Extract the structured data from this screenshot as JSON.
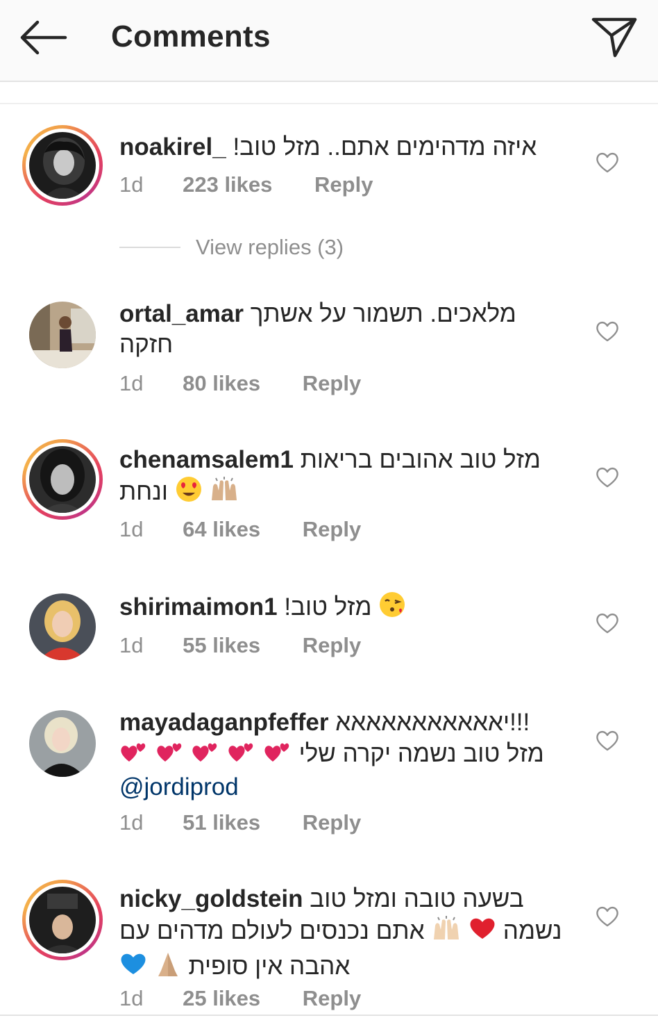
{
  "header": {
    "title": "Comments",
    "back_icon": "arrow-left-icon",
    "send_icon": "paper-plane-icon"
  },
  "colors": {
    "text": "#262626",
    "secondary": "#8e8e8e",
    "mention": "#003569",
    "story_ring": "#e4405f"
  },
  "comments": [
    {
      "username": "noakirel_",
      "text": "איזה מדהימים אתם.. מזל טוב!",
      "time": "1d",
      "likes": "223 likes",
      "reply": "Reply",
      "has_story_ring": true
    },
    {
      "username": "ortal_amar",
      "text": "מלאכים. תשמור על אשתך חזקה",
      "time": "1d",
      "likes": "80 likes",
      "reply": "Reply",
      "has_story_ring": false
    },
    {
      "username": "chenamsalem1",
      "text": "מזל טוב אהובים בריאות ונחת",
      "emojis": [
        "heart-eyes-emoji",
        "raising-hands-emoji"
      ],
      "time": "1d",
      "likes": "64 likes",
      "reply": "Reply",
      "has_story_ring": true
    },
    {
      "username": "shirimaimon1",
      "text": "מזל טוב!",
      "emojis": [
        "kissing-heart-emoji"
      ],
      "time": "1d",
      "likes": "55 likes",
      "reply": "Reply",
      "has_story_ring": false
    },
    {
      "username": "mayadaganpfeffer",
      "text_line1": "יאאאאאאאאאאא!!!",
      "text_line2": "מזל טוב נשמה יקרה שלי",
      "emojis": [
        "two-hearts-emoji",
        "two-hearts-emoji",
        "two-hearts-emoji",
        "two-hearts-emoji",
        "two-hearts-emoji"
      ],
      "mention": "@jordiprod",
      "time": "1d",
      "likes": "51 likes",
      "reply": "Reply",
      "has_story_ring": false
    },
    {
      "username": "nicky_goldstein",
      "text_line1": "בשעה טובה ומזל טוב",
      "text_line2a": "נשמה",
      "text_line2b": "אתם נכנסים לעולם מדהים עם",
      "text_line3": "אהבה אין סופית",
      "emojis": [
        "red-heart-emoji",
        "raising-hands-emoji",
        "blue-heart-emoji",
        "folded-hands-emoji"
      ],
      "time": "1d",
      "likes": "25 likes",
      "reply": "Reply",
      "has_story_ring": true
    }
  ],
  "view_replies": "View replies (3)"
}
